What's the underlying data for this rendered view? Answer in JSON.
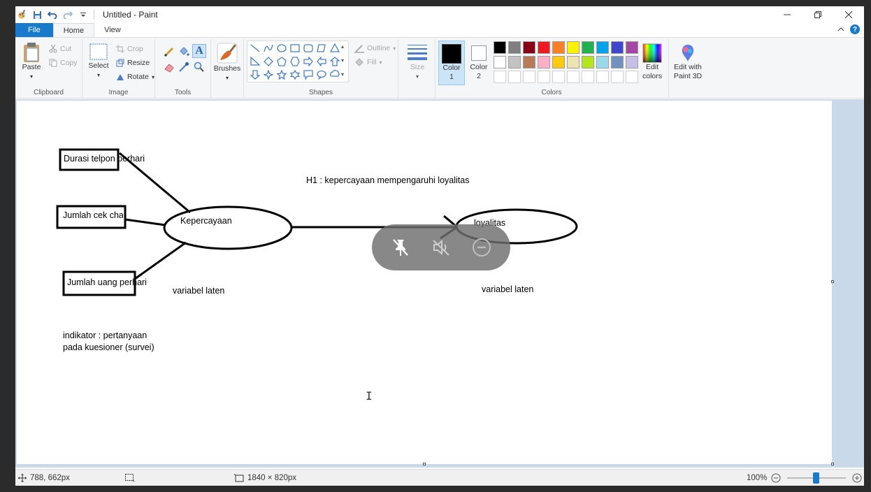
{
  "window": {
    "title": "Untitled - Paint",
    "controls": {
      "minimize": "minimize-icon",
      "restore": "restore-icon",
      "close": "close-icon"
    }
  },
  "tabs": [
    {
      "label": "File"
    },
    {
      "label": "Home"
    },
    {
      "label": "View"
    }
  ],
  "ribbon": {
    "clipboard": {
      "label": "Clipboard",
      "paste": "Paste",
      "cut": "Cut",
      "copy": "Copy"
    },
    "image": {
      "label": "Image",
      "select": "Select",
      "crop": "Crop",
      "resize": "Resize",
      "rotate": "Rotate"
    },
    "tools": {
      "label": "Tools"
    },
    "brushes": {
      "label": "Brushes"
    },
    "shapes": {
      "label": "Shapes",
      "outline": "Outline",
      "fill": "Fill"
    },
    "size": {
      "label": "Size"
    },
    "colors": {
      "label": "Colors",
      "color1": {
        "line1": "Color",
        "line2": "1",
        "value": "#000000"
      },
      "color2": {
        "line1": "Color",
        "line2": "2",
        "value": "#ffffff"
      },
      "palette_row1": [
        "#000000",
        "#7f7f7f",
        "#880015",
        "#ed1c24",
        "#ff7f27",
        "#fff200",
        "#22b14c",
        "#00a2e8",
        "#3f48cc",
        "#a349a4"
      ],
      "palette_row2": [
        "#ffffff",
        "#c3c3c3",
        "#b97a57",
        "#ffaec9",
        "#ffc90e",
        "#efe4b0",
        "#b5e61d",
        "#99d9ea",
        "#7092be",
        "#c8bfe7"
      ],
      "edit_colors": {
        "line1": "Edit",
        "line2": "colors"
      },
      "edit_3d": {
        "line1": "Edit with",
        "line2": "Paint 3D"
      }
    }
  },
  "canvas": {
    "indicator1": "Durasi telpon perhari",
    "indicator2": "Jumlah cek chat",
    "indicator3": "Jumlah uang perhari",
    "latent1": "Kepercayaan",
    "latent2": "loyalitas",
    "latent_label1": "variabel laten",
    "latent_label2": "variabel laten",
    "hypothesis": "H1 : kepercayaan mempengaruhi loyalitas",
    "note_line1": "indikator : pertanyaan",
    "note_line2": "pada kuesioner (survei)"
  },
  "overlay": {
    "unpin": "unpin-icon",
    "mute": "mute-icon",
    "minus": "minus-circle-icon"
  },
  "statusbar": {
    "cursor_pos": "788, 662px",
    "canvas_size": "1840 × 820px",
    "zoom": "100%"
  }
}
